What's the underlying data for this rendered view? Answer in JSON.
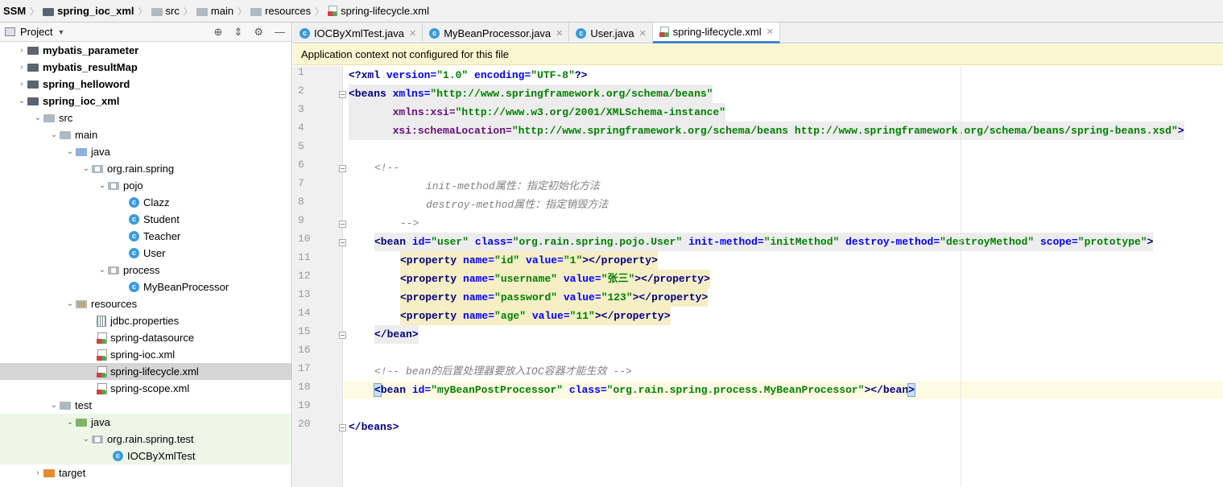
{
  "breadcrumb": {
    "items": [
      "SSM",
      "spring_ioc_xml",
      "src",
      "main",
      "resources",
      "spring-lifecycle.xml"
    ]
  },
  "project_panel": {
    "title": "Project",
    "tree": [
      {
        "label": "mybatis_parameter",
        "type": "module",
        "bold": true
      },
      {
        "label": "mybatis_resultMap",
        "type": "module",
        "bold": true
      },
      {
        "label": "spring_helloword",
        "type": "module",
        "bold": true
      },
      {
        "label": "spring_ioc_xml",
        "type": "module",
        "bold": true
      },
      {
        "label": "src"
      },
      {
        "label": "main"
      },
      {
        "label": "java"
      },
      {
        "label": "org.rain.spring"
      },
      {
        "label": "pojo"
      },
      {
        "label": "Clazz"
      },
      {
        "label": "Student"
      },
      {
        "label": "Teacher"
      },
      {
        "label": "User"
      },
      {
        "label": "process"
      },
      {
        "label": "MyBeanProcessor"
      },
      {
        "label": "resources"
      },
      {
        "label": "jdbc.properties"
      },
      {
        "label": "spring-datasource"
      },
      {
        "label": "spring-ioc.xml"
      },
      {
        "label": "spring-lifecycle.xml",
        "selected": true
      },
      {
        "label": "spring-scope.xml"
      },
      {
        "label": "test"
      },
      {
        "label": "java"
      },
      {
        "label": "org.rain.spring.test"
      },
      {
        "label": "IOCByXmlTest"
      },
      {
        "label": "target"
      }
    ]
  },
  "tabs": [
    {
      "label": "IOCByXmlTest.java",
      "icon": "class-icon"
    },
    {
      "label": "MyBeanProcessor.java",
      "icon": "class-icon"
    },
    {
      "label": "User.java",
      "icon": "class-icon"
    },
    {
      "label": "spring-lifecycle.xml",
      "icon": "xml-file-icon",
      "active": true
    }
  ],
  "notice": "Application context not configured for this file",
  "code": {
    "line_numbers": [
      "1",
      "2",
      "3",
      "4",
      "5",
      "6",
      "7",
      "8",
      "9",
      "10",
      "11",
      "12",
      "13",
      "14",
      "15",
      "16",
      "17",
      "18",
      "19",
      "20"
    ],
    "l1": {
      "open": "<?xml ",
      "a1": "version=",
      "v1": "\"1.0\"",
      "a2": " encoding=",
      "v2": "\"UTF-8\"",
      "close": "?>"
    },
    "l2": {
      "tag": "<beans ",
      "attr": "xmlns=",
      "val": "\"http://www.springframework.org/schema/beans\""
    },
    "l3": {
      "attr": "xmlns:xsi=",
      "val": "\"http://www.w3.org/2001/XMLSchema-instance\""
    },
    "l4": {
      "attr": "xsi:schemaLocation=",
      "val": "\"http://www.springframework.org/schema/beans http://www.springframework.org/schema/beans/spring-beans.xsd\"",
      "close": ">"
    },
    "l6": "<!--",
    "l7": "init-method属性：指定初始化方法",
    "l8": "destroy-method属性：指定销毁方法",
    "l9": "-->",
    "l10": {
      "tag": "<bean ",
      "a1": "id=",
      "v1": "\"user\"",
      "a2": " class=",
      "v2": "\"org.rain.spring.pojo.User\"",
      "a3": " init-method=",
      "v3": "\"initMethod\"",
      "a4": " destroy-method=",
      "v4": "\"destroyMethod\"",
      "a5": " scope=",
      "v5": "\"prototype\"",
      "close": ">"
    },
    "props": [
      {
        "name": "\"id\"",
        "value": "\"1\""
      },
      {
        "name": "\"username\"",
        "value": "\"张三\""
      },
      {
        "name": "\"password\"",
        "value": "\"123\""
      },
      {
        "name": "\"age\"",
        "value": "\"11\""
      }
    ],
    "prop_open": "<property ",
    "prop_name_attr": "name=",
    "prop_value_attr": " value=",
    "prop_close": "></property>",
    "l15": "</bean>",
    "l17": "<!-- bean的后置处理器要放入IOC容器才能生效 -->",
    "l18": {
      "tag": "<bean ",
      "a1": "id=",
      "v1": "\"myBeanPostProcessor\"",
      "a2": " class=",
      "v2": "\"org.rain.spring.process.MyBeanProcessor\"",
      "close1": "></bean",
      "close2": ">"
    },
    "l20": "</beans>"
  }
}
